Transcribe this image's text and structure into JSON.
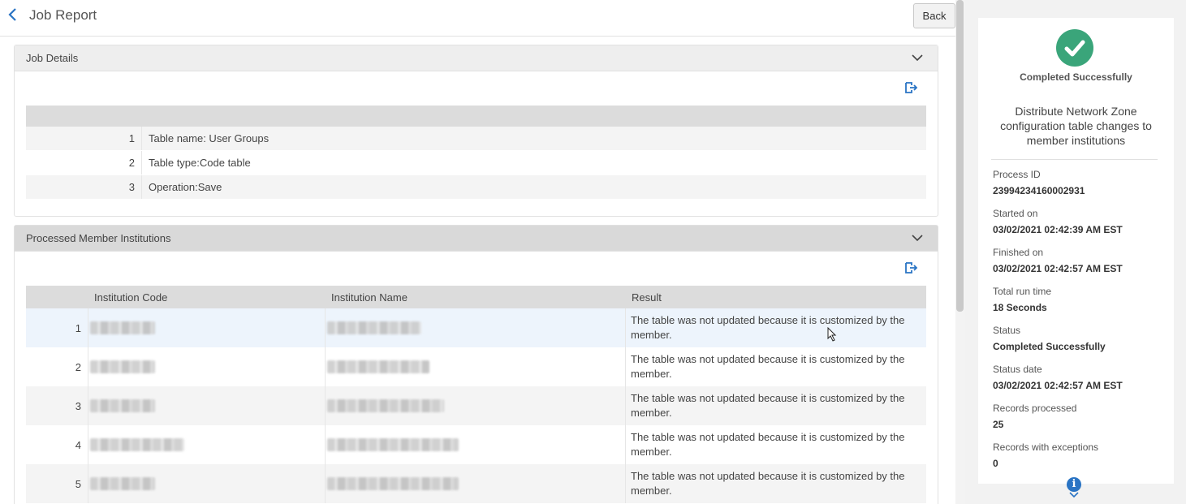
{
  "header": {
    "title": "Job Report",
    "back_label": "Back"
  },
  "job_details": {
    "title": "Job Details",
    "rows": [
      {
        "num": "1",
        "text": "Table name: User Groups"
      },
      {
        "num": "2",
        "text": "Table type:Code table"
      },
      {
        "num": "3",
        "text": "Operation:Save"
      }
    ]
  },
  "processed": {
    "title": "Processed Member Institutions",
    "columns": [
      "Institution Code",
      "Institution Name",
      "Result"
    ],
    "rows": [
      {
        "num": "1",
        "result": "The table was not updated because it is customized by the member."
      },
      {
        "num": "2",
        "result": "The table was not updated because it is customized by the member."
      },
      {
        "num": "3",
        "result": "The table was not updated because it is customized by the member."
      },
      {
        "num": "4",
        "result": "The table was not updated because it is customized by the member."
      },
      {
        "num": "5",
        "result": "The table was not updated because it is customized by the member."
      }
    ]
  },
  "side": {
    "status_label": "Completed Successfully",
    "job_title": "Distribute Network Zone configuration table changes to member institutions",
    "fields": [
      {
        "label": "Process ID",
        "value": "23994234160002931"
      },
      {
        "label": "Started on",
        "value": "03/02/2021 02:42:39 AM EST"
      },
      {
        "label": "Finished on",
        "value": "03/02/2021 02:42:57 AM EST"
      },
      {
        "label": "Total run time",
        "value": "18 Seconds"
      },
      {
        "label": "Status",
        "value": "Completed Successfully"
      },
      {
        "label": "Status date",
        "value": "03/02/2021 02:42:57 AM EST"
      },
      {
        "label": "Records processed",
        "value": "25"
      },
      {
        "label": "Records with exceptions",
        "value": "0"
      }
    ]
  },
  "colors": {
    "accent": "#2a74c4",
    "success": "#3aa57a"
  },
  "icons": [
    "chevron-left-icon",
    "chevron-down-icon",
    "export-icon",
    "check-icon",
    "info-icon"
  ]
}
